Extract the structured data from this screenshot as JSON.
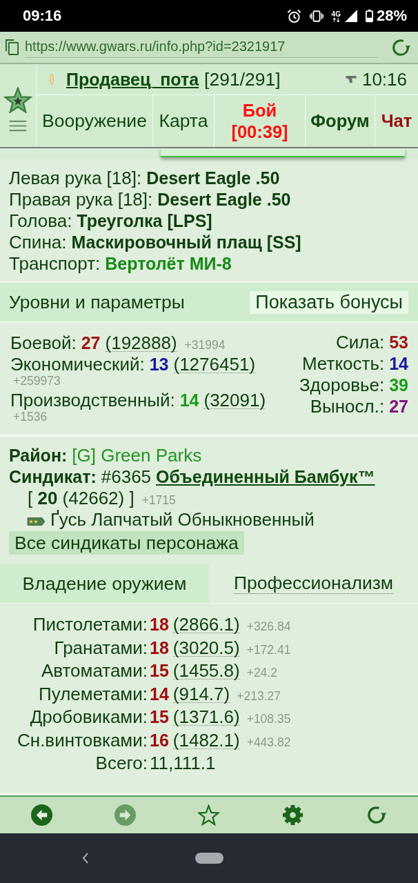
{
  "status_bar": {
    "time": "09:16",
    "network": "4G",
    "battery": "28%"
  },
  "url_bar": {
    "url": "https://www.gwars.ru/info.php?id=2321917"
  },
  "header": {
    "player": "Продавец_пота",
    "health": "[291/291]",
    "clock": "10:16"
  },
  "nav_tabs": [
    {
      "label": "Вооружение",
      "kind": "plain"
    },
    {
      "label": "Карта",
      "kind": "plain"
    },
    {
      "label": "Бой",
      "timer": "[00:39]",
      "kind": "alert"
    },
    {
      "label": "Форум",
      "kind": "strong"
    },
    {
      "label": "Чат",
      "kind": "hot"
    }
  ],
  "equipment": [
    {
      "slot": "Левая рука [18]:",
      "item": "Desert Eagle .50",
      "kind": "item"
    },
    {
      "slot": "Правая рука [18]:",
      "item": "Desert Eagle .50",
      "kind": "item"
    },
    {
      "slot": "Голова:",
      "item": "Треуголка [LPS]",
      "kind": "item"
    },
    {
      "slot": "Спина:",
      "item": "Маскировочный плащ [SS]",
      "kind": "item"
    },
    {
      "slot": "Транспорт:",
      "item": "Вертолёт МИ-8",
      "kind": "transport"
    }
  ],
  "levels_panel": {
    "title": "Уровни и параметры",
    "button": "Показать бонусы"
  },
  "levels": [
    {
      "label": "Боевой:",
      "rank": "27",
      "experience": "(192888)",
      "gain": "+31994",
      "color": "#a31515"
    },
    {
      "label": "Экономический:",
      "rank": "13",
      "experience": "(1276451)",
      "gain": "+259973",
      "color": "#1818a0"
    },
    {
      "label": "Производственный:",
      "rank": "14",
      "experience": "(32091)",
      "gain": "+1536",
      "color": "#1c9c1c"
    }
  ],
  "stats": [
    {
      "label": "Сила:",
      "value": "53",
      "color": "#a31515"
    },
    {
      "label": "Меткость:",
      "value": "14",
      "color": "#1818a0"
    },
    {
      "label": "Здоровье:",
      "value": "39",
      "color": "#1c9c1c"
    },
    {
      "label": "Выносл.:",
      "value": "27",
      "color": "#801480"
    }
  ],
  "district": {
    "label": "Район:",
    "value": "[G] Green Parks"
  },
  "syndicate": {
    "label": "Синдикат:",
    "number": "#6365",
    "name": "Объединенный Бамбук™",
    "standing": "[ **20** (42662) ]",
    "gain": "+1715",
    "rank_title": "Ґусь Лапчатый Обныкновенный",
    "button": "Все синдикаты персонажа"
  },
  "skill_tabs": [
    {
      "label": "Владение оружием",
      "selected": true
    },
    {
      "label": "Профессионализм",
      "selected": false
    }
  ],
  "skills": [
    {
      "kind": "skill",
      "label": "Пистолетами:",
      "rank": "18",
      "experience": "(2866.1)",
      "gain": "+326.84"
    },
    {
      "kind": "skill",
      "label": "Гранатами:",
      "rank": "18",
      "experience": "(3020.5)",
      "gain": "+172.41"
    },
    {
      "kind": "skill",
      "label": "Автоматами:",
      "rank": "15",
      "experience": "(1455.8)",
      "gain": "+24.2"
    },
    {
      "kind": "skill",
      "label": "Пулеметами:",
      "rank": "14",
      "experience": "(914.7)",
      "gain": "+213.27"
    },
    {
      "kind": "skill",
      "label": "Дробовиками:",
      "rank": "15",
      "experience": "(1371.6)",
      "gain": "+108.35"
    },
    {
      "kind": "skill",
      "label": "Сн.винтовками:",
      "rank": "16",
      "experience": "(1482.1)",
      "gain": "+443.82"
    },
    {
      "kind": "total",
      "label": "Всего:",
      "value": "11,111.1"
    }
  ],
  "browser_toolbar": {
    "back_disabled": false,
    "forward_disabled": true
  }
}
